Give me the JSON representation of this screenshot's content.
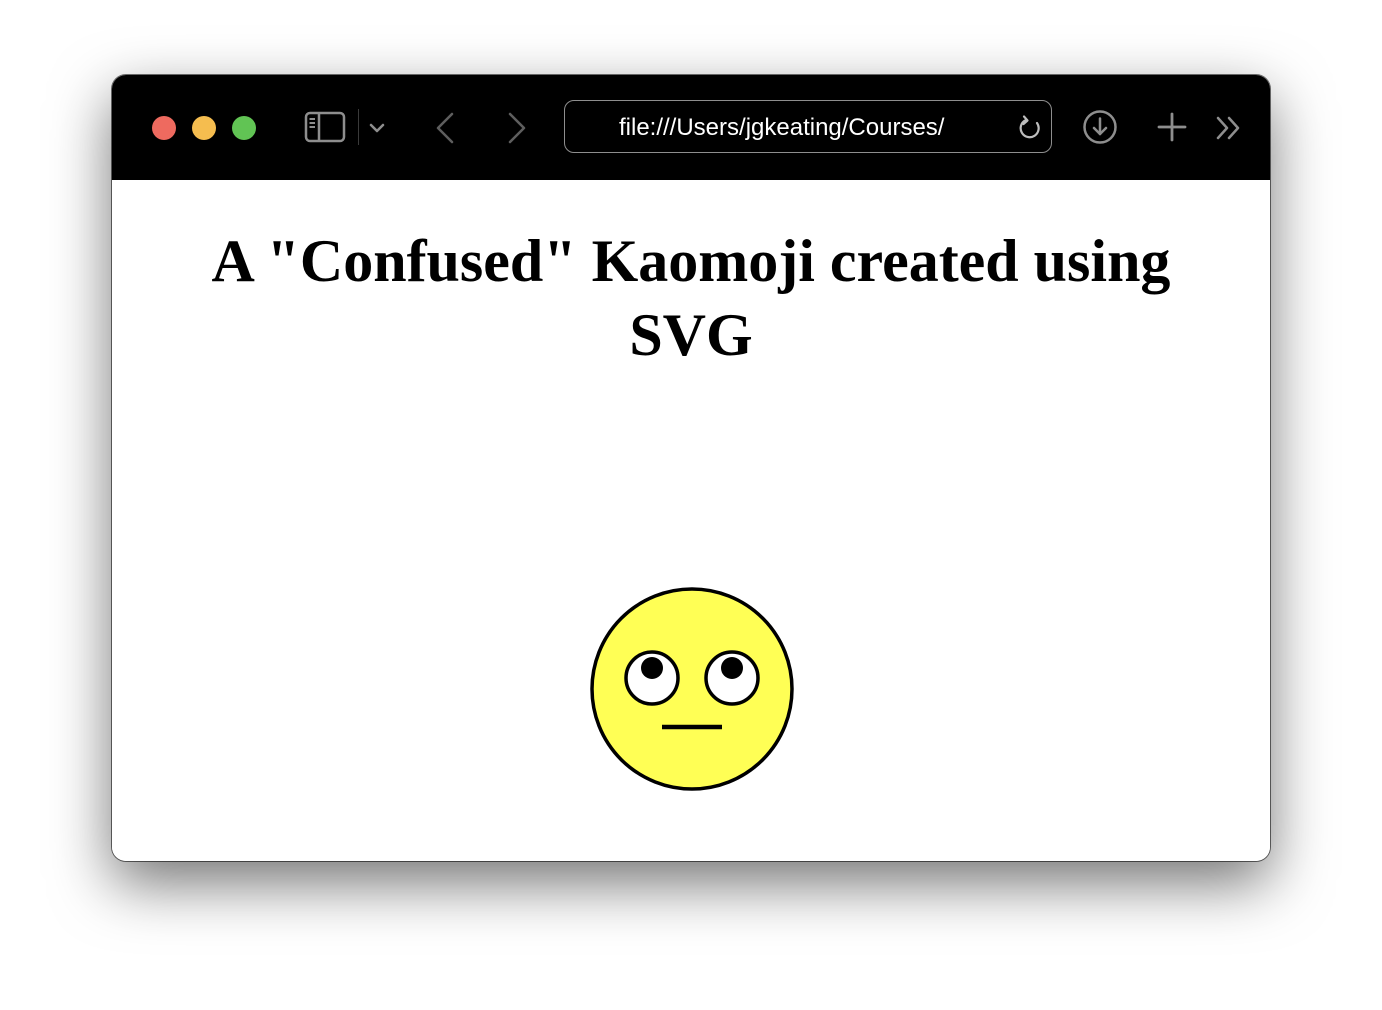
{
  "colors": {
    "traffic_close": "#ee6a5f",
    "traffic_minimize": "#f5bd4f",
    "traffic_maximize": "#61c454",
    "toolbar_background": "#000000",
    "toolbar_icon": "#8e8e8e",
    "face_fill": "#ffff55",
    "face_stroke": "#000000",
    "eye_white": "#ffffff",
    "pupil": "#000000"
  },
  "browser": {
    "url": "file:///Users/jgkeating/Courses/",
    "icons": {
      "close": "close-traffic-light",
      "minimize": "minimize-traffic-light",
      "maximize": "maximize-traffic-light",
      "sidebar": "sidebar-icon",
      "sidebar_menu": "chevron-down-icon",
      "back": "chevron-left-icon",
      "forward": "chevron-right-icon",
      "reload": "reload-icon",
      "downloads": "download-icon",
      "new_tab": "plus-icon",
      "more": "double-chevron-right-icon"
    }
  },
  "page": {
    "title": "A \"Confused\" Kaomoji created using SVG",
    "graphic": {
      "icon": "confused-kaomoji-face"
    }
  }
}
